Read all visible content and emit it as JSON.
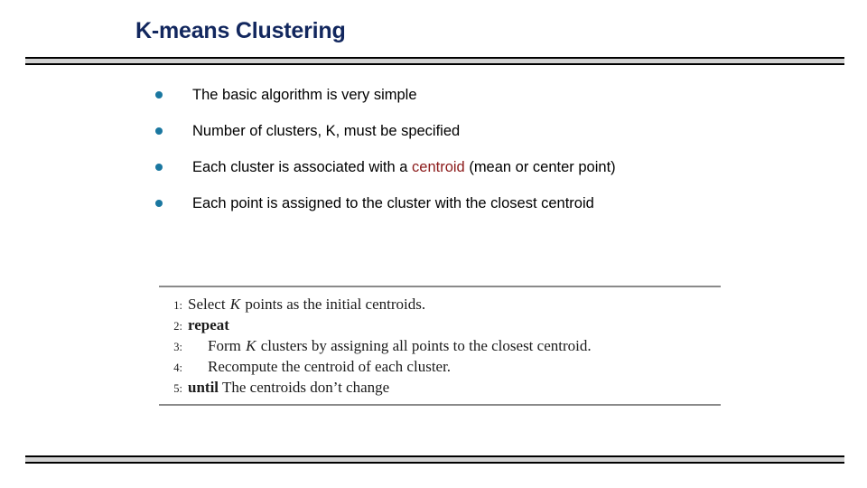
{
  "slide": {
    "title": "K-means Clustering",
    "accent_color": "#12275e",
    "bullet_color": "#1a77a0",
    "highlight_color": "#8b1a1a",
    "rule_fill_color": "#d2d2d2",
    "rule_border_color": "#000000",
    "algo_rule_color": "#8a8a8a"
  },
  "bullets": [
    {
      "id": "bullet-1",
      "marker": "bullet-dot-icon",
      "parts": [
        {
          "text": "The basic algorithm is very simple",
          "style": "normal"
        }
      ],
      "justified": false
    },
    {
      "id": "bullet-2",
      "marker": "bullet-dot-icon",
      "parts": [
        {
          "text": "Number of clusters, K, must be specified",
          "style": "normal"
        }
      ],
      "justified": false
    },
    {
      "id": "bullet-3",
      "marker": "bullet-dot-icon",
      "parts": [
        {
          "text": "Each cluster is associated with a ",
          "style": "normal"
        },
        {
          "text": "centroid",
          "style": "highlight"
        },
        {
          "text": " (mean or center point)",
          "style": "normal"
        }
      ],
      "justified": false
    },
    {
      "id": "bullet-4",
      "marker": "bullet-dot-icon",
      "parts": [
        {
          "text": "Each point is assigned to the cluster with the closest centroid",
          "style": "normal"
        }
      ],
      "justified": true
    }
  ],
  "algorithm": {
    "lines": [
      {
        "number": "1:",
        "indent": false,
        "parts": [
          {
            "text": "Select ",
            "style": "normal"
          },
          {
            "text": "K",
            "style": "math"
          },
          {
            "text": " points as the initial centroids.",
            "style": "normal"
          }
        ]
      },
      {
        "number": "2:",
        "indent": false,
        "parts": [
          {
            "text": "repeat",
            "style": "keyword"
          }
        ]
      },
      {
        "number": "3:",
        "indent": true,
        "parts": [
          {
            "text": "Form ",
            "style": "normal"
          },
          {
            "text": "K",
            "style": "math"
          },
          {
            "text": " clusters by assigning all points to the closest centroid.",
            "style": "normal"
          }
        ]
      },
      {
        "number": "4:",
        "indent": true,
        "parts": [
          {
            "text": "Recompute the centroid of each cluster.",
            "style": "normal"
          }
        ]
      },
      {
        "number": "5:",
        "indent": false,
        "parts": [
          {
            "text": "until",
            "style": "keyword"
          },
          {
            "text": " The centroids don’t change",
            "style": "normal"
          }
        ]
      }
    ]
  }
}
